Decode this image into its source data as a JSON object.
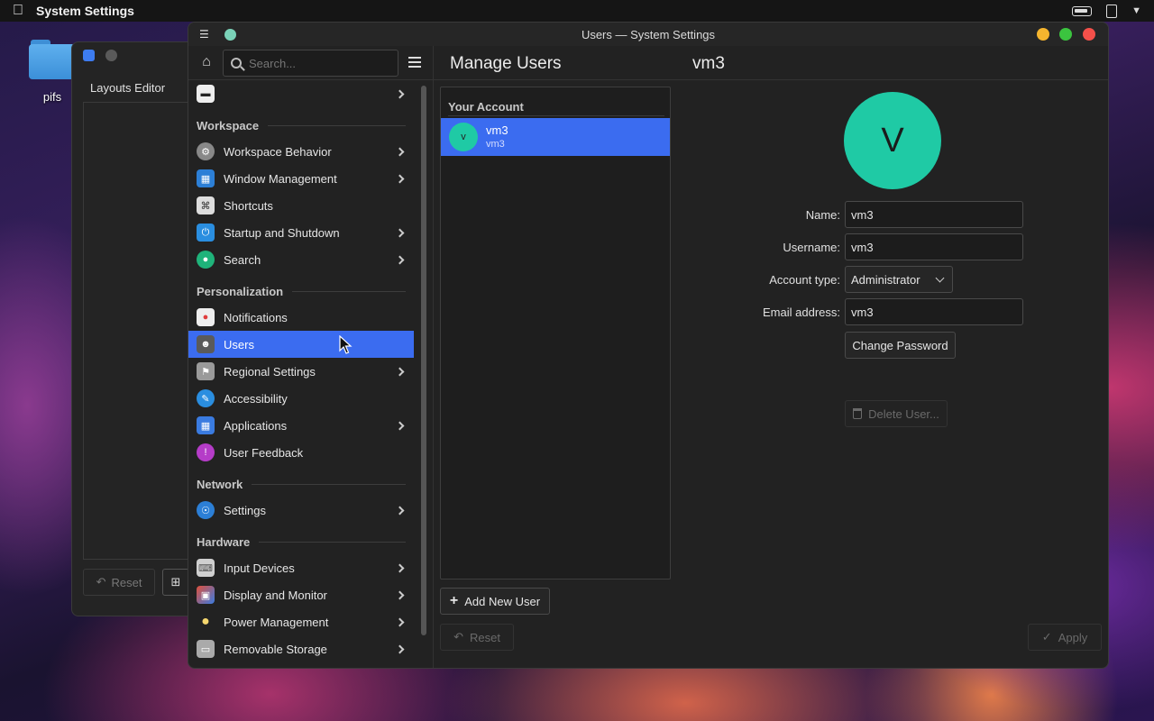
{
  "menubar": {
    "app_name": "System Settings"
  },
  "desktop": {
    "folder_label": "pifs"
  },
  "bg_window": {
    "tab_label": "Layouts Editor",
    "reset_label": "Reset"
  },
  "window": {
    "title": "Users — System Settings",
    "page_title": "Manage Users",
    "user_title": "vm3"
  },
  "search": {
    "placeholder": "Search..."
  },
  "sidebar": {
    "sections": {
      "workspace": "Workspace",
      "personalization": "Personalization",
      "network": "Network",
      "hardware": "Hardware"
    },
    "items": {
      "workspace_behavior": "Workspace Behavior",
      "window_management": "Window Management",
      "shortcuts": "Shortcuts",
      "startup_shutdown": "Startup and Shutdown",
      "search": "Search",
      "notifications": "Notifications",
      "users": "Users",
      "regional": "Regional Settings",
      "accessibility": "Accessibility",
      "applications": "Applications",
      "user_feedback": "User Feedback",
      "settings": "Settings",
      "input_devices": "Input Devices",
      "display_monitor": "Display and Monitor",
      "power_management": "Power Management",
      "removable_storage": "Removable Storage"
    }
  },
  "accounts": {
    "header": "Your Account",
    "user": {
      "initial": "v",
      "name": "vm3",
      "username": "vm3"
    },
    "add_button": "Add New User",
    "reset_button": "Reset"
  },
  "details": {
    "avatar_initial": "V",
    "name_label": "Name:",
    "name_value": "vm3",
    "username_label": "Username:",
    "username_value": "vm3",
    "account_type_label": "Account type:",
    "account_type_value": "Administrator",
    "email_label": "Email address:",
    "email_value": "vm3",
    "change_password": "Change Password",
    "delete_user": "Delete User...",
    "apply": "Apply"
  },
  "colors": {
    "accent": "#3b6cf0",
    "avatar": "#1fcaa5",
    "window_bg": "#222222"
  }
}
